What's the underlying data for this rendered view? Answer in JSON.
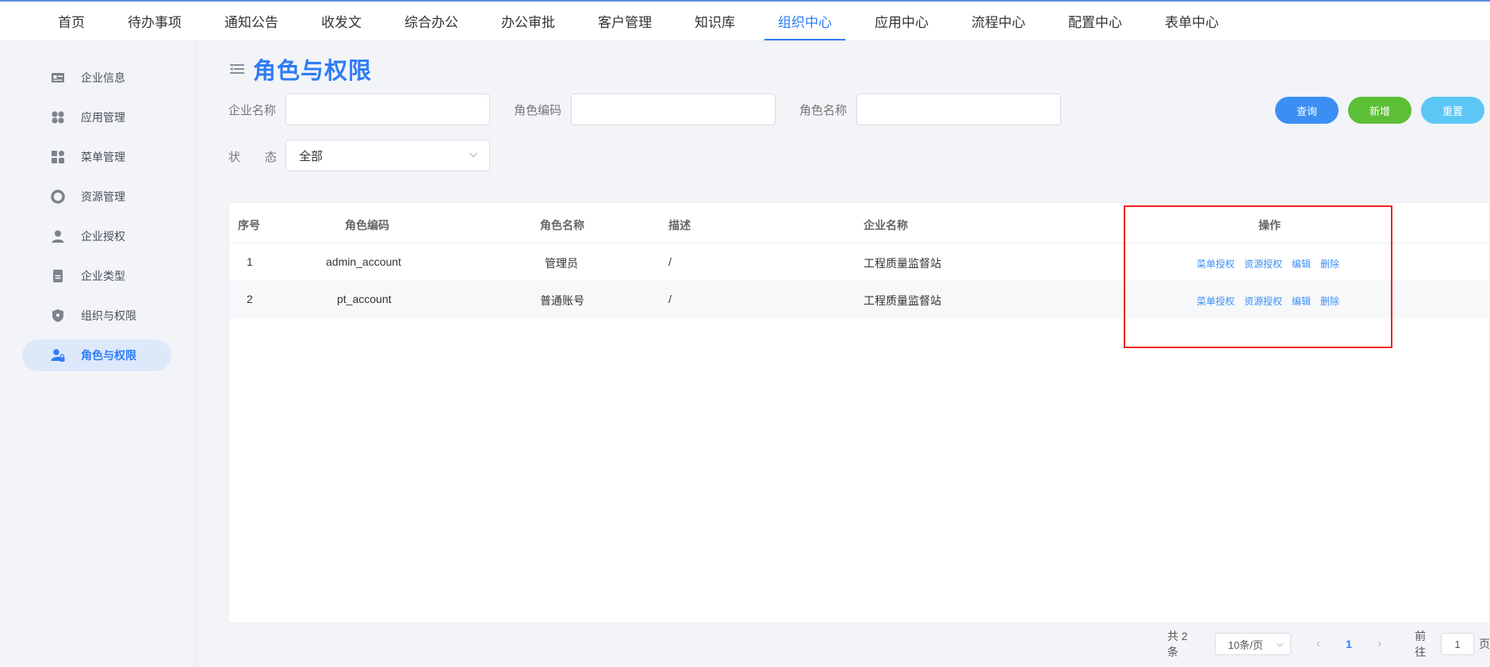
{
  "topnav": {
    "items": [
      "首页",
      "待办事项",
      "通知公告",
      "收发文",
      "综合办公",
      "办公审批",
      "客户管理",
      "知识库",
      "组织中心",
      "应用中心",
      "流程中心",
      "配置中心",
      "表单中心"
    ],
    "active_index": 8
  },
  "sidebar": {
    "items": [
      {
        "label": "企业信息",
        "icon": "id-card-icon"
      },
      {
        "label": "应用管理",
        "icon": "apps-grid-icon"
      },
      {
        "label": "菜单管理",
        "icon": "menu-grid-icon"
      },
      {
        "label": "资源管理",
        "icon": "resource-ring-icon"
      },
      {
        "label": "企业授权",
        "icon": "user-icon"
      },
      {
        "label": "企业类型",
        "icon": "document-icon"
      },
      {
        "label": "组织与权限",
        "icon": "shield-icon"
      },
      {
        "label": "角色与权限",
        "icon": "user-lock-icon"
      }
    ],
    "active_index": 7
  },
  "page": {
    "title": "角色与权限"
  },
  "filters": {
    "company_label": "企业名称",
    "company_value": "",
    "role_code_label": "角色编码",
    "role_code_value": "",
    "role_name_label": "角色名称",
    "role_name_value": "",
    "status_label_1": "状",
    "status_label_2": "态",
    "status_value": "全部"
  },
  "buttons": {
    "query": "查询",
    "add": "新增",
    "reset": "重置"
  },
  "table": {
    "headers": {
      "index": "序号",
      "role_code": "角色编码",
      "role_name": "角色名称",
      "description": "描述",
      "company": "企业名称",
      "actions": "操作"
    },
    "rows": [
      {
        "index": "1",
        "role_code": "admin_account",
        "role_name": "管理员",
        "description": "/",
        "company": "工程质量监督站"
      },
      {
        "index": "2",
        "role_code": "pt_account",
        "role_name": "普通账号",
        "description": "/",
        "company": "工程质量监督站"
      }
    ],
    "actions": {
      "menu_auth": "菜单授权",
      "resource_auth": "资源授权",
      "edit": "编辑",
      "delete": "删除"
    }
  },
  "pagination": {
    "total_text": "共 2 条",
    "page_size": "10条/页",
    "prev": "‹",
    "current_page": "1",
    "next": "›",
    "goto_label": "前往",
    "goto_value": "1",
    "page_suffix": "页"
  },
  "colors": {
    "accent": "#2f7cf6",
    "add_green": "#5cbf36",
    "reset_cyan": "#5cc7f5",
    "highlight_red": "#f02020"
  }
}
